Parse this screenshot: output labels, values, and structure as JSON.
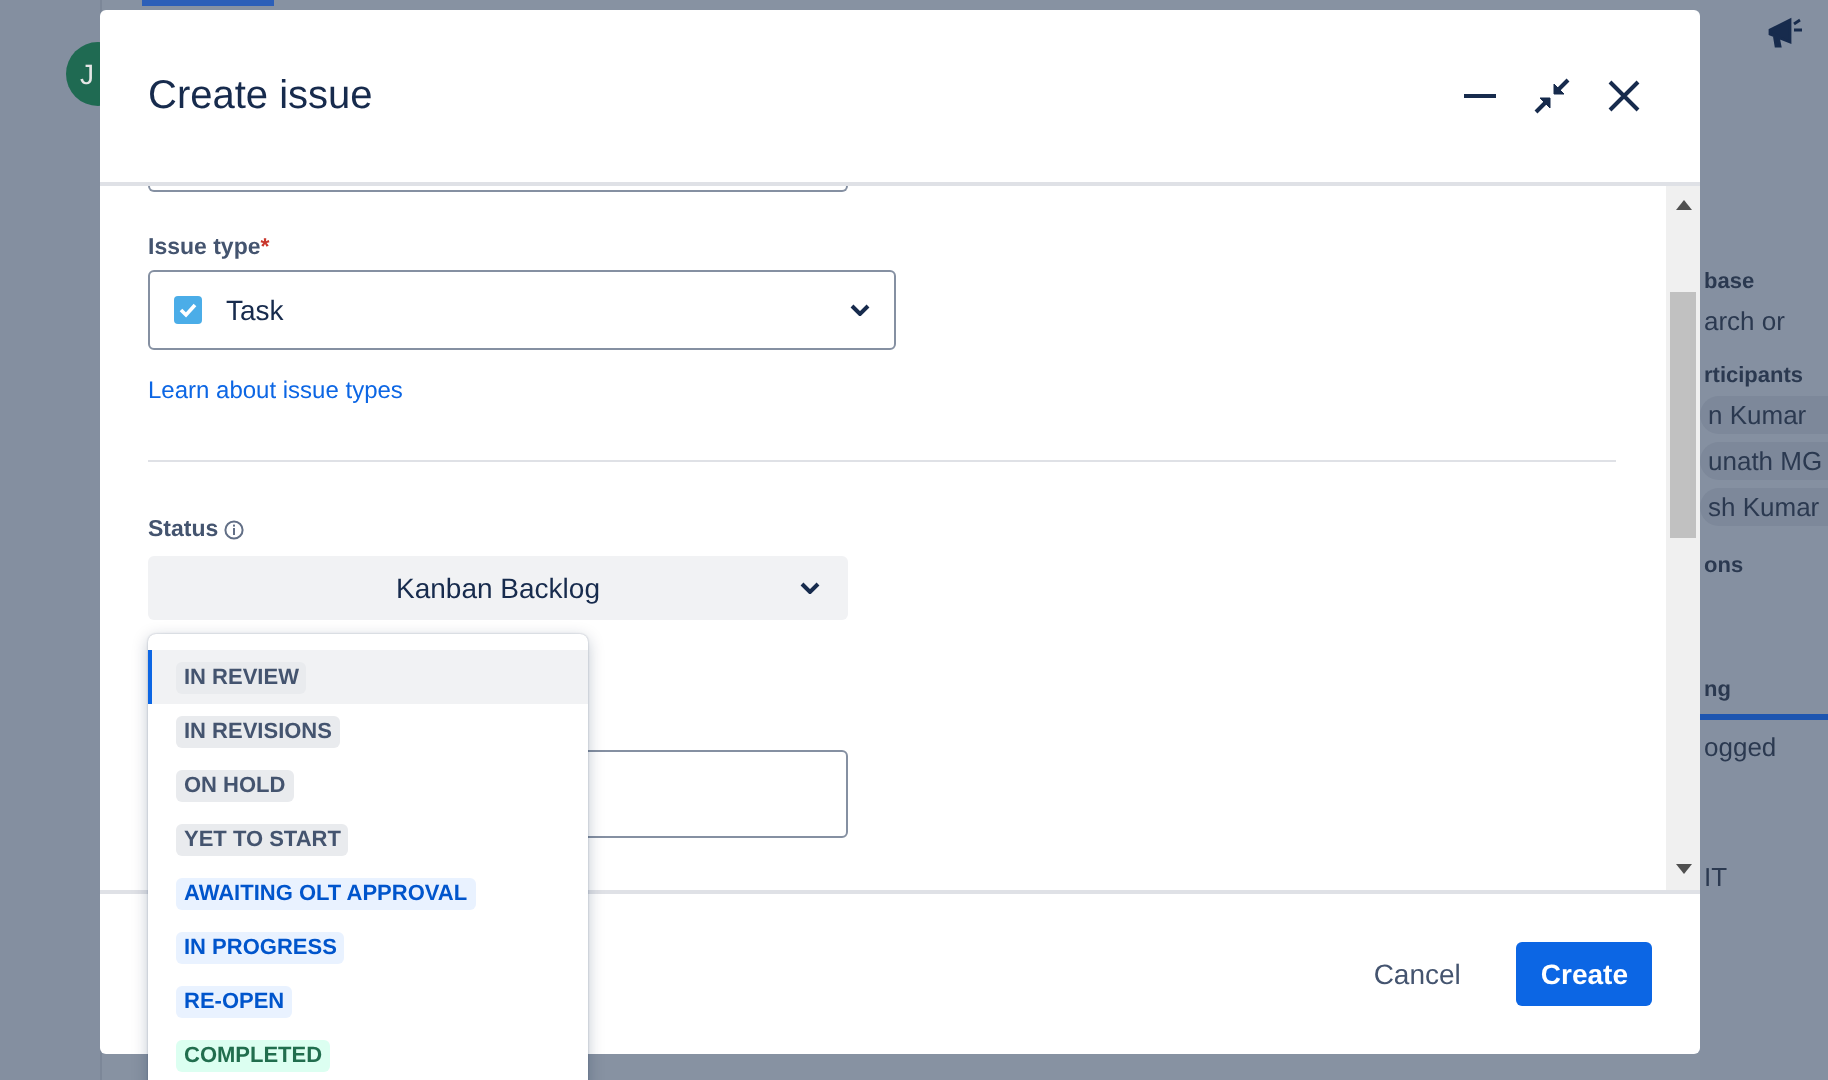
{
  "background": {
    "avatar_initial": "J",
    "side_texts": [
      {
        "text": "base",
        "kind": "heading"
      },
      {
        "text": "arch or",
        "kind": "value"
      },
      {
        "text": "rticipants",
        "kind": "heading"
      },
      {
        "text": "n Kumar",
        "kind": "chip"
      },
      {
        "text": "unath MG",
        "kind": "chip"
      },
      {
        "text": "sh Kumar",
        "kind": "chip"
      },
      {
        "text": "ons",
        "kind": "heading"
      },
      {
        "text": "ng",
        "kind": "tab"
      },
      {
        "text": "ogged",
        "kind": "value"
      },
      {
        "text": "IT",
        "kind": "value"
      }
    ]
  },
  "dialog": {
    "title": "Create issue",
    "issue_type": {
      "label": "Issue type",
      "required_mark": "*",
      "value": "Task",
      "checked": true,
      "help_link": "Learn about issue types"
    },
    "status": {
      "label": "Status",
      "value": "Kanban Backlog"
    },
    "status_options": [
      {
        "label": "IN REVIEW",
        "kind": "neutral",
        "selected": true
      },
      {
        "label": "IN REVISIONS",
        "kind": "neutral",
        "selected": false
      },
      {
        "label": "ON HOLD",
        "kind": "neutral",
        "selected": false
      },
      {
        "label": "YET TO START",
        "kind": "neutral",
        "selected": false
      },
      {
        "label": "AWAITING OLT APPROVAL",
        "kind": "progress",
        "selected": false
      },
      {
        "label": "IN PROGRESS",
        "kind": "progress",
        "selected": false
      },
      {
        "label": "RE-OPEN",
        "kind": "progress",
        "selected": false
      },
      {
        "label": "COMPLETED",
        "kind": "done",
        "selected": false
      }
    ],
    "buttons": [
      {
        "label": "Cancel",
        "kind": "subtle"
      },
      {
        "label": "Create",
        "kind": "primary"
      }
    ]
  }
}
